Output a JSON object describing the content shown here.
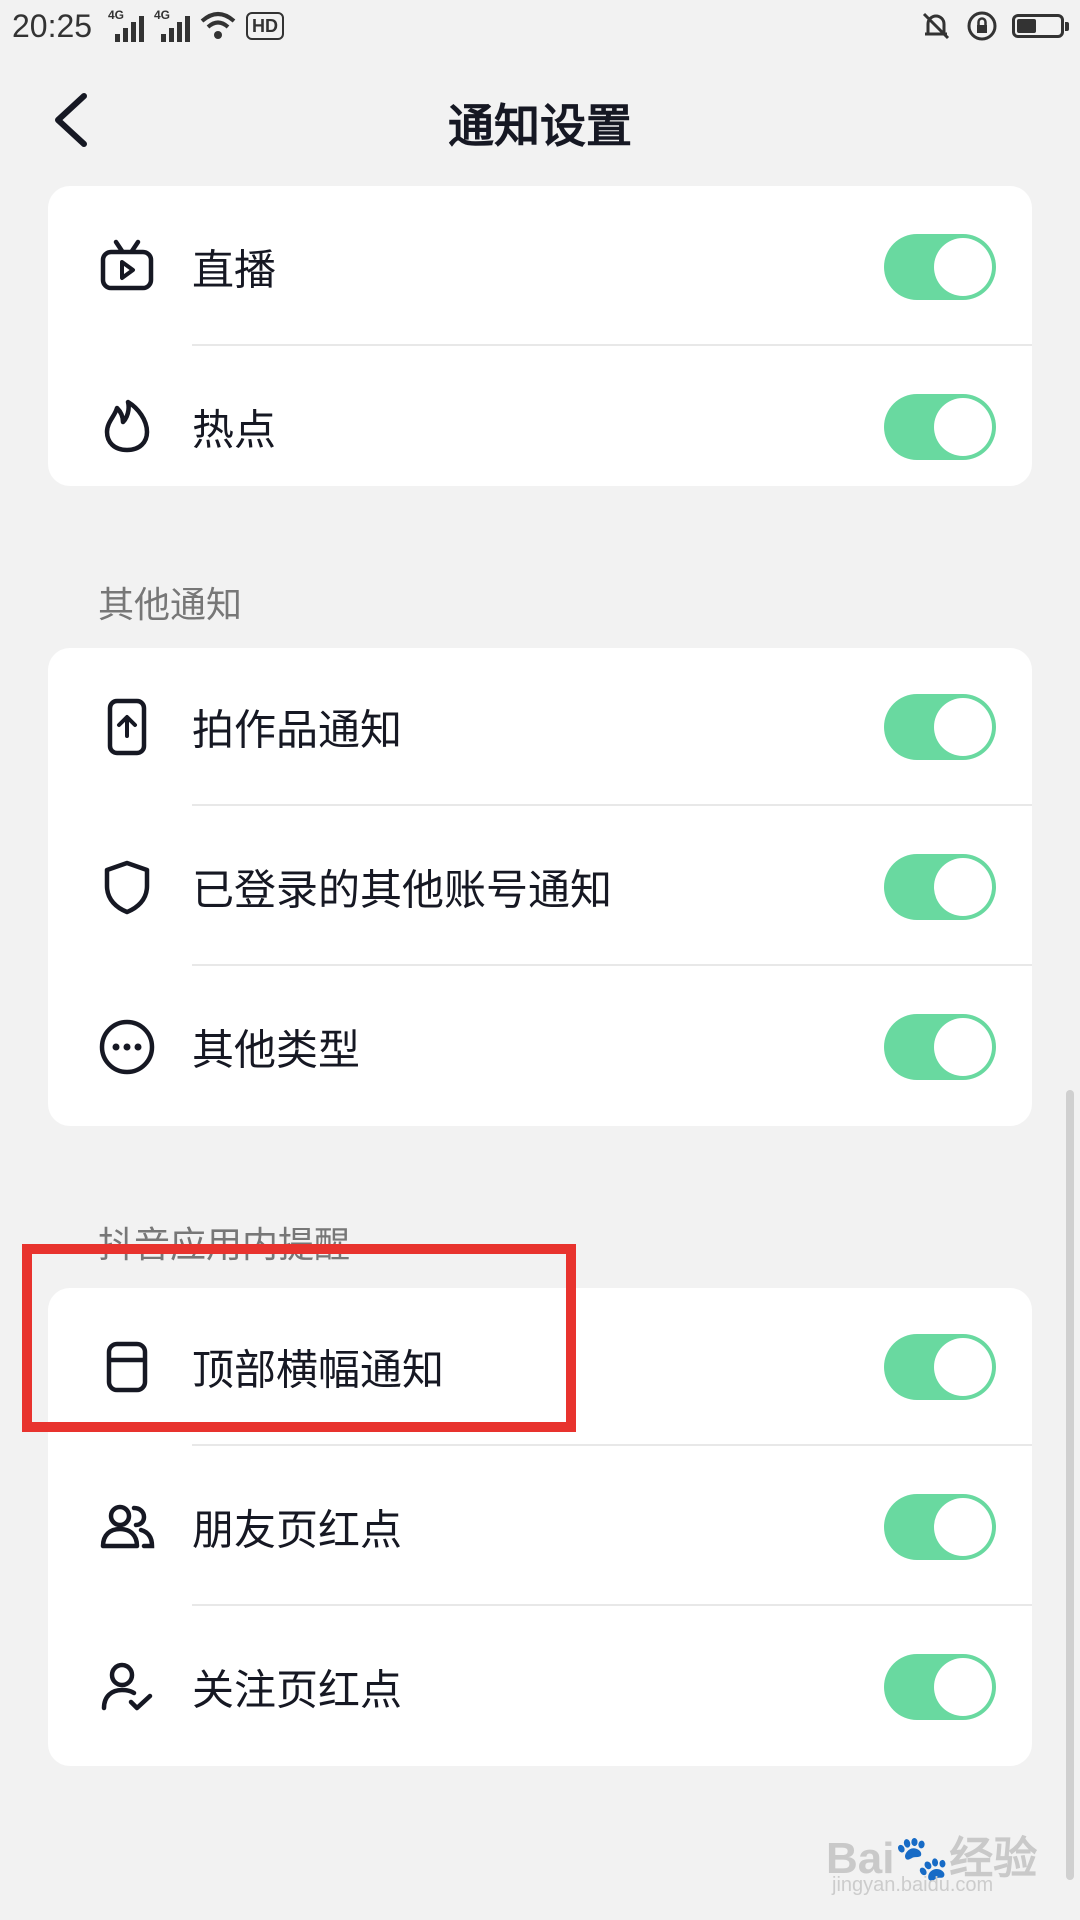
{
  "status_bar": {
    "time": "20:25",
    "signal1_label": "4G",
    "signal2_label": "4G",
    "hd_label": "HD",
    "battery_level": 0.45,
    "icons": [
      "signal-icon",
      "signal-icon",
      "wifi-icon",
      "hd-icon",
      "bell-muted-icon",
      "rotation-lock-icon",
      "battery-icon"
    ]
  },
  "header": {
    "title": "通知设置",
    "back_icon": "chevron-left-icon"
  },
  "groups": [
    {
      "section_title": "",
      "items": [
        {
          "label": "直播",
          "icon": "live-tv-icon",
          "toggle_on": true
        },
        {
          "label": "热点",
          "icon": "flame-icon",
          "toggle_on": true
        }
      ]
    },
    {
      "section_title": "其他通知",
      "items": [
        {
          "label": "拍作品通知",
          "icon": "phone-upload-icon",
          "toggle_on": true
        },
        {
          "label": "已登录的其他账号通知",
          "icon": "shield-icon",
          "toggle_on": true
        },
        {
          "label": "其他类型",
          "icon": "more-circle-icon",
          "toggle_on": true
        }
      ]
    },
    {
      "section_title": "抖音应用内提醒",
      "items": [
        {
          "label": "顶部横幅通知",
          "icon": "banner-icon",
          "toggle_on": true
        },
        {
          "label": "朋友页红点",
          "icon": "friends-icon",
          "toggle_on": true
        },
        {
          "label": "关注页红点",
          "icon": "user-check-icon",
          "toggle_on": true
        }
      ]
    }
  ],
  "colors": {
    "toggle_on": "#69d9a0",
    "highlight": "#e8332e",
    "background": "#f2f2f2"
  },
  "watermark": {
    "brand": "Bai",
    "brand2": "经验",
    "url": "jingyan.baidu.com"
  }
}
